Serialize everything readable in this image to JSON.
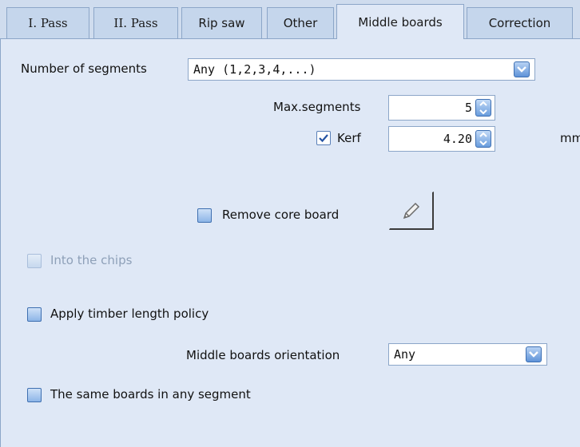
{
  "tabs": [
    {
      "label": "I. Pass"
    },
    {
      "label": "II. Pass"
    },
    {
      "label": "Rip saw"
    },
    {
      "label": "Other"
    },
    {
      "label": "Middle boards"
    },
    {
      "label": "Correction"
    }
  ],
  "active_tab": "Middle boards",
  "segments": {
    "label": "Number of segments",
    "value": "Any (1,2,3,4,...)"
  },
  "max_segments": {
    "label": "Max.segments",
    "value": "5"
  },
  "kerf": {
    "label": "Kerf",
    "checked": true,
    "value": "4.20",
    "unit": "mm"
  },
  "remove_core": {
    "label": "Remove core board",
    "checked": false,
    "edit_icon": "pencil-icon"
  },
  "into_chips": {
    "label": "Into the chips",
    "checked": false,
    "enabled": false
  },
  "timber_policy": {
    "label": "Apply timber length policy",
    "checked": false
  },
  "orientation": {
    "label": "Middle boards orientation",
    "value": "Any"
  },
  "same_boards": {
    "label": "The same boards in any segment",
    "checked": false
  },
  "colors": {
    "background": "#dfe8f6",
    "tab": "#c5d6ec",
    "border": "#8ca6c8",
    "button_blue": "#5f93d8"
  }
}
